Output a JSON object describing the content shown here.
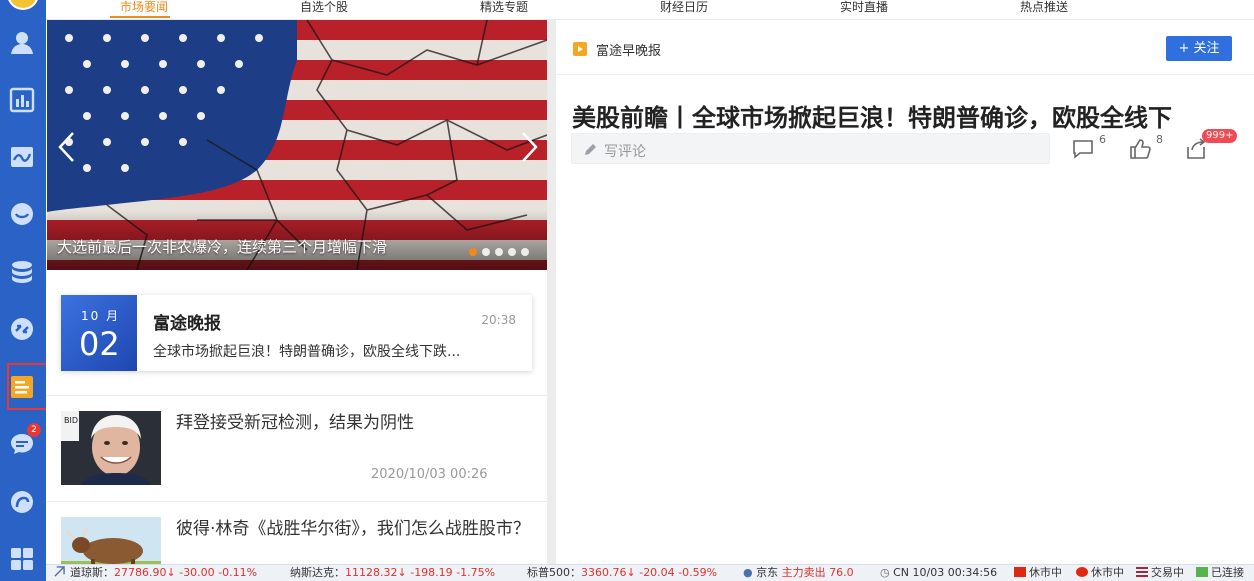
{
  "nav": {
    "tabs": [
      "市场要闻",
      "自选个股",
      "精选专题",
      "财经日历",
      "实时直播",
      "热点推送"
    ],
    "active": 0
  },
  "sidebar": {
    "icons": [
      "user-icon",
      "bar-chart-icon",
      "trend-chart-icon",
      "face-icon",
      "coins-icon",
      "swap-icon",
      "news-icon",
      "chat-icon",
      "nn-logo-icon",
      "apps-grid-icon"
    ],
    "chat_badge": "2",
    "selected": "news-icon"
  },
  "carousel": {
    "caption": "大选前最后一次非农爆冷，连续第三个月增幅下滑",
    "dot_count": 5,
    "active_dot": 0
  },
  "evening_report": {
    "month": "10 月",
    "day": "02",
    "title": "富途晚报",
    "time": "20:38",
    "summary": "全球市场掀起巨浪！特朗普确诊，欧股全线下跌..."
  },
  "news": [
    {
      "title": "拜登接受新冠检测，结果为阴性",
      "date": "2020/10/03 00:26",
      "thumb_label": "BID"
    },
    {
      "title": "彼得·林奇《战胜华尔街》，我们怎么战胜股市？",
      "date": ""
    }
  ],
  "article": {
    "source": "富途早晚报",
    "follow_label": "+ 关注",
    "title": "美股前瞻丨全球市场掀起巨浪！特朗普确诊，欧股全线下",
    "comment_placeholder": "写评论",
    "comment_count": "6",
    "like_count": "8",
    "share_badge": "999+"
  },
  "status": {
    "dow_label": "道琼斯：",
    "dow_value": "27786.90",
    "dow_change": "-30.00",
    "dow_pct": "-0.11%",
    "nasdaq_label": "纳斯达克：",
    "nasdaq_value": "11128.32",
    "nasdaq_change": "-198.19",
    "nasdaq_pct": "-1.75%",
    "sp_label": "标普500：",
    "sp_value": "3360.76",
    "sp_change": "-20.04",
    "sp_pct": "-0.59%",
    "jd_label": "京东",
    "jd_flow": "主力卖出 76.0",
    "clock": "CN 10/03 00:34:56",
    "cn_state": "休市中",
    "hk_state": "休市中",
    "us_state": "交易中",
    "conn_state": "已连接"
  },
  "colors": {
    "sidebar": "#2a62c6",
    "accent": "#f08a1d",
    "follow": "#2f6fde",
    "down": "#e2312b",
    "badge": "#ef4b55"
  }
}
